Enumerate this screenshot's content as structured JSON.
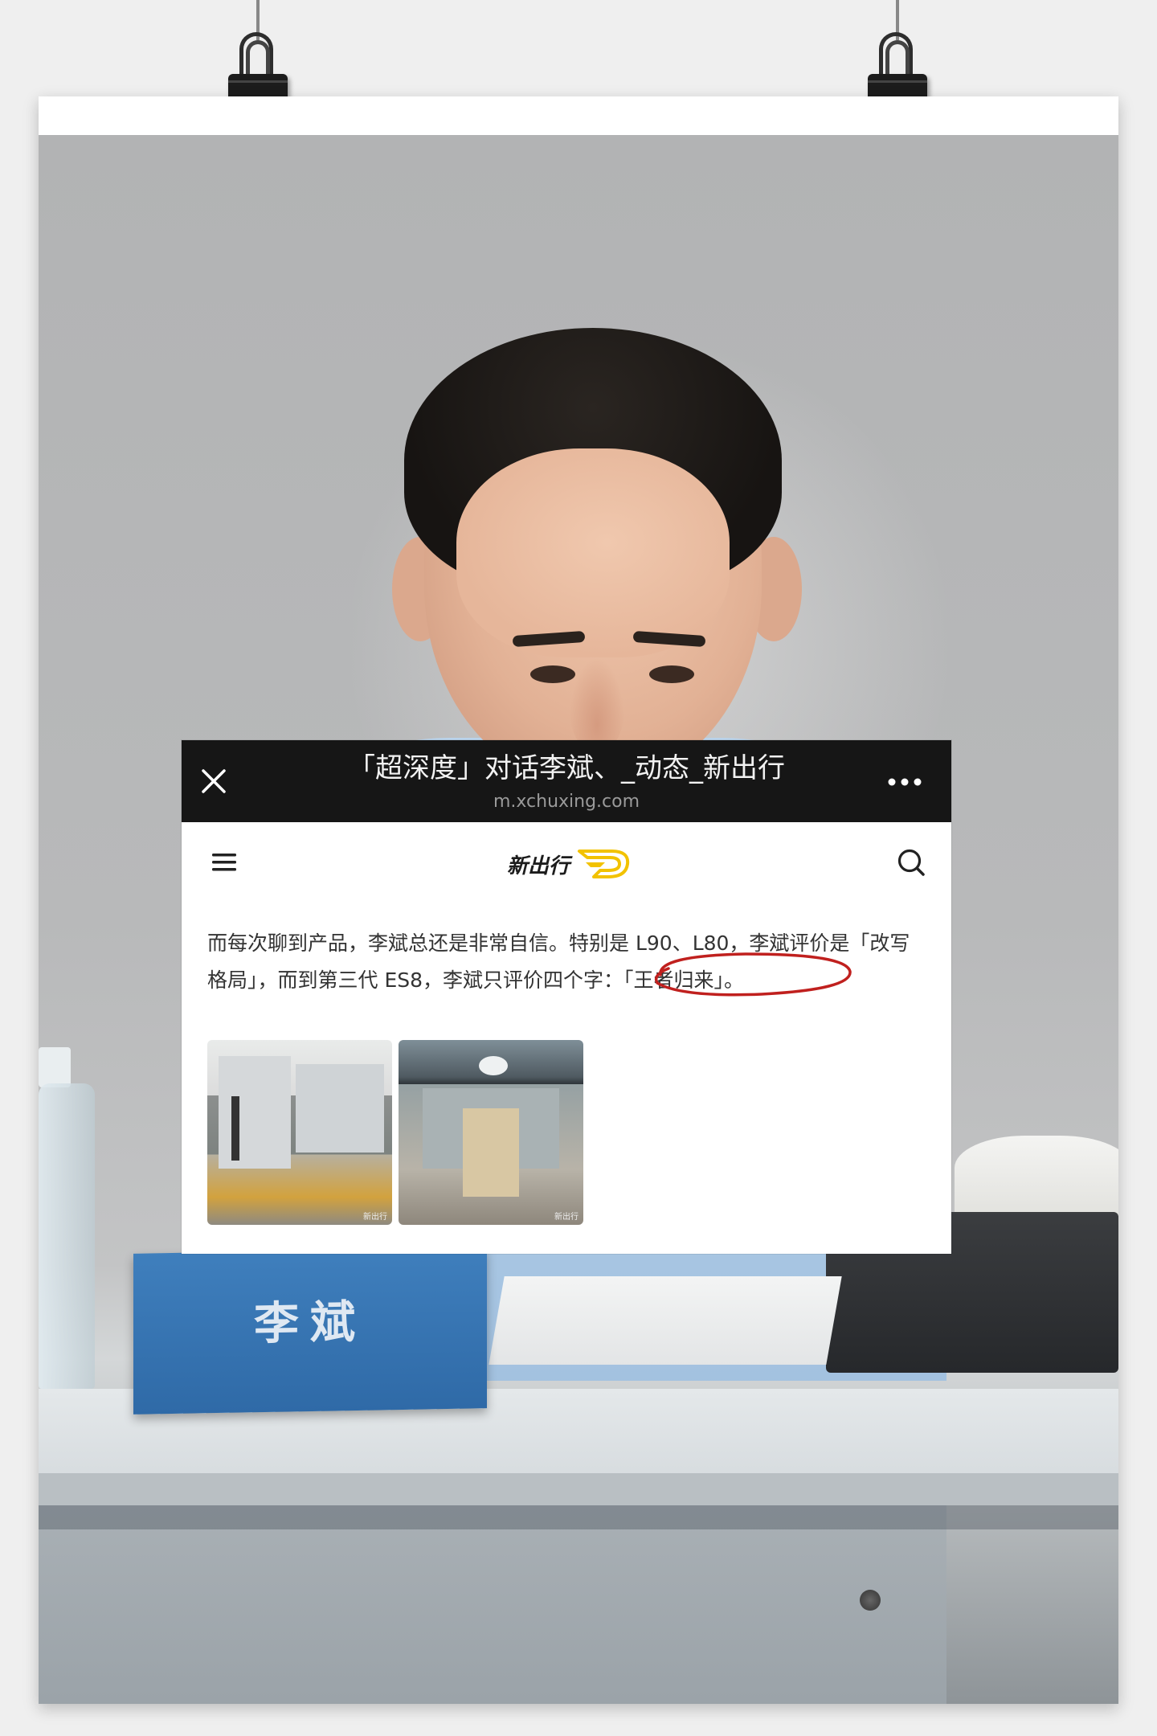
{
  "header": {
    "title": "「超深度」对话李斌、_动态_新出行",
    "url": "m.xchuxing.com"
  },
  "site": {
    "logo_text": "新出行",
    "accent_color": "#f2c200"
  },
  "article": {
    "paragraph": "而每次聊到产品，李斌总还是非常自信。特别是 L90、L80，李斌评价是「改写格局」，而到第三代 ES8，李斌只评价四个字：「王者归来」。",
    "images": [
      {
        "watermark": "新出行"
      },
      {
        "watermark": "新出行"
      }
    ]
  },
  "photo": {
    "nameplate": "李斌"
  },
  "icons": {
    "close": "close-icon",
    "more": "more-icon",
    "menu": "menu-icon",
    "search": "search-icon"
  }
}
